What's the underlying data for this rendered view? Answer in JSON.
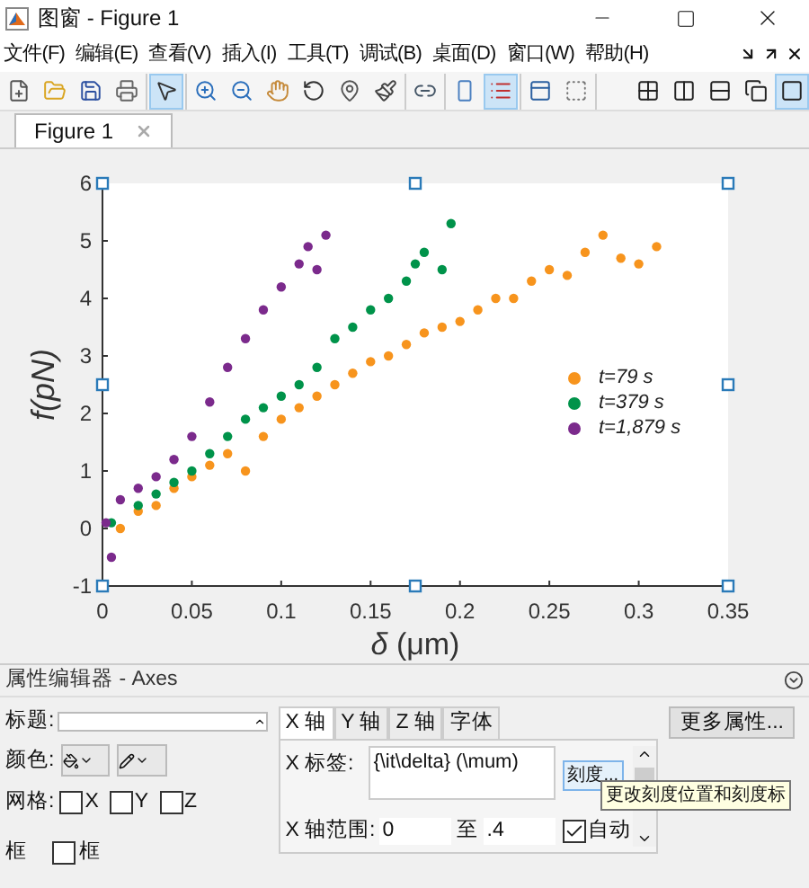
{
  "window": {
    "title": "图窗 - Figure 1"
  },
  "menu": [
    "文件(F)",
    "编辑(E)",
    "查看(V)",
    "插入(I)",
    "工具(T)",
    "调试(B)",
    "桌面(D)",
    "窗口(W)",
    "帮助(H)"
  ],
  "toolbar": [
    {
      "kind": "new",
      "selected": false
    },
    {
      "kind": "open",
      "selected": false
    },
    {
      "kind": "save",
      "selected": false
    },
    {
      "kind": "print",
      "selected": false
    },
    {
      "kind": "pointer",
      "selected": true
    },
    {
      "kind": "zoom-in",
      "selected": false
    },
    {
      "kind": "zoom-out",
      "selected": false
    },
    {
      "kind": "pan",
      "selected": false
    },
    {
      "kind": "rotate",
      "selected": false
    },
    {
      "kind": "datatip",
      "selected": false
    },
    {
      "kind": "brush",
      "selected": false
    },
    {
      "kind": "link",
      "selected": false
    },
    {
      "kind": "colorbar",
      "selected": false
    },
    {
      "kind": "legend",
      "selected": true
    },
    {
      "kind": "hide",
      "selected": false
    },
    {
      "kind": "show",
      "selected": false
    }
  ],
  "layout_buttons": [
    {
      "kind": "grid4",
      "selected": false
    },
    {
      "kind": "cols2",
      "selected": false
    },
    {
      "kind": "rows2",
      "selected": false
    },
    {
      "kind": "float",
      "selected": false
    },
    {
      "kind": "single",
      "selected": true
    }
  ],
  "tabs": [
    {
      "label": "Figure 1",
      "selected": true
    }
  ],
  "chart_data": {
    "type": "scatter",
    "legend": "right",
    "xlabel": "*δ* (μm)",
    "ylabel": "f(pN)",
    "xlim": [
      0,
      0.35
    ],
    "ylim": [
      -1,
      6
    ],
    "xticks": [
      {
        "value": 0,
        "label": "0"
      },
      {
        "value": 0.05,
        "label": "0.05"
      },
      {
        "value": 0.1,
        "label": "0.1"
      },
      {
        "value": 0.15,
        "label": "0.15"
      },
      {
        "value": 0.2,
        "label": "0.2"
      },
      {
        "value": 0.25,
        "label": "0.25"
      },
      {
        "value": 0.3,
        "label": "0.3"
      },
      {
        "value": 0.35,
        "label": "0.35"
      }
    ],
    "yticks": [
      {
        "value": -1,
        "label": "-1"
      },
      {
        "value": 0,
        "label": "0"
      },
      {
        "value": 1,
        "label": "1"
      },
      {
        "value": 2,
        "label": "2"
      },
      {
        "value": 3,
        "label": "3"
      },
      {
        "value": 4,
        "label": "4"
      },
      {
        "value": 5,
        "label": "5"
      },
      {
        "value": 6,
        "label": "6"
      }
    ],
    "series": [
      {
        "name": "t=79 s",
        "color": "#f7941d",
        "x": [
          0.01,
          0.02,
          0.03,
          0.04,
          0.05,
          0.06,
          0.07,
          0.08,
          0.09,
          0.1,
          0.11,
          0.12,
          0.13,
          0.14,
          0.15,
          0.16,
          0.17,
          0.18,
          0.19,
          0.2,
          0.21,
          0.22,
          0.23,
          0.24,
          0.25,
          0.26,
          0.27,
          0.28,
          0.29,
          0.3,
          0.31
        ],
        "values": [
          0,
          0.3,
          0.4,
          0.7,
          0.9,
          1.1,
          1.3,
          1.0,
          1.6,
          1.9,
          2.1,
          2.3,
          2.5,
          2.7,
          2.9,
          3.0,
          3.2,
          3.4,
          3.5,
          3.6,
          3.8,
          4.0,
          4.0,
          4.3,
          4.5,
          4.4,
          4.8,
          5.1,
          4.7,
          4.6,
          4.9
        ]
      },
      {
        "name": "t=379 s",
        "color": "#00934a",
        "x": [
          0.005,
          0.02,
          0.03,
          0.04,
          0.05,
          0.06,
          0.07,
          0.08,
          0.09,
          0.1,
          0.11,
          0.12,
          0.13,
          0.14,
          0.15,
          0.16,
          0.17,
          0.175,
          0.18,
          0.19,
          0.195
        ],
        "values": [
          0.1,
          0.4,
          0.6,
          0.8,
          1.0,
          1.3,
          1.6,
          1.9,
          2.1,
          2.3,
          2.5,
          2.8,
          3.3,
          3.5,
          3.8,
          4.0,
          4.3,
          4.6,
          4.8,
          4.5,
          5.3
        ]
      },
      {
        "name": "t=1,879 s",
        "color": "#7b2a8c",
        "x": [
          0.002,
          0.005,
          0.01,
          0.02,
          0.03,
          0.04,
          0.05,
          0.06,
          0.07,
          0.08,
          0.09,
          0.1,
          0.11,
          0.115,
          0.12,
          0.125
        ],
        "values": [
          0.1,
          -0.5,
          0.5,
          0.7,
          0.9,
          1.2,
          1.6,
          2.2,
          2.8,
          3.3,
          3.8,
          4.2,
          4.6,
          4.9,
          4.5,
          5.1
        ]
      }
    ]
  },
  "property_editor": {
    "title": "属性编辑器 - Axes",
    "title_label": "标题:",
    "color_label": "颜色:",
    "grid_label": "网格:",
    "grid": [
      {
        "label": "X",
        "checked": false
      },
      {
        "label": "Y",
        "checked": false
      },
      {
        "label": "Z",
        "checked": false
      }
    ],
    "box_label": "框",
    "box": {
      "label": "框",
      "checked": false
    },
    "tabs": [
      {
        "label": "X 轴",
        "selected": true
      },
      {
        "label": "Y 轴",
        "selected": false
      },
      {
        "label": "Z 轴",
        "selected": false
      },
      {
        "label": "字体",
        "selected": false
      }
    ],
    "xlabel_label": "X 标签:",
    "xlabel_value": "{\\it\\delta} (\\mum)",
    "ticks_button": "刻度...",
    "range_label": "X 轴范围:",
    "range_from": "0",
    "range_to_label": "至",
    "range_to": ".4",
    "auto": {
      "label": "自动",
      "checked": true
    },
    "more_button": "更多属性...",
    "tooltip": "更改刻度位置和刻度标"
  }
}
